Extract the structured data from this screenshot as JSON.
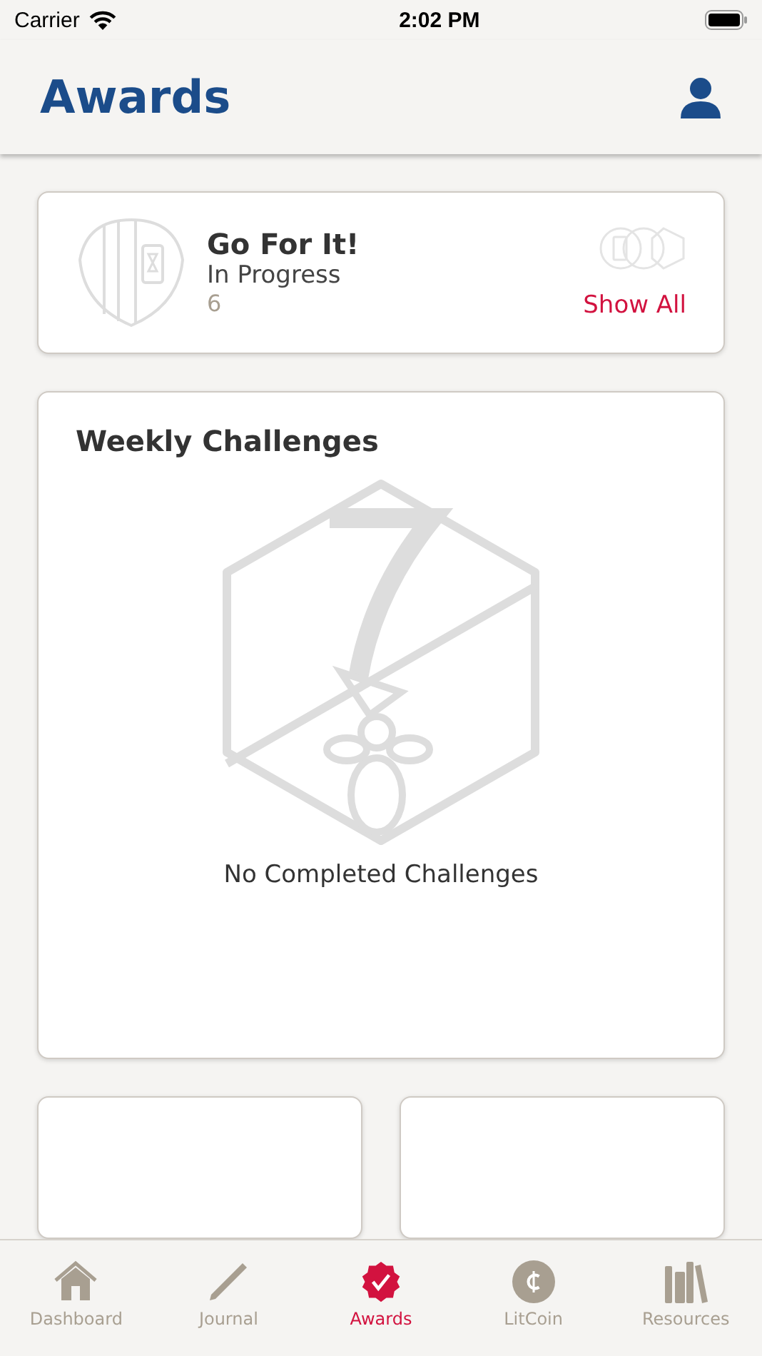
{
  "status_bar": {
    "carrier": "Carrier",
    "time": "2:02 PM"
  },
  "header": {
    "title": "Awards"
  },
  "current_award": {
    "title": "Go For It!",
    "status": "In Progress",
    "count": "6",
    "link": "Show All"
  },
  "weekly": {
    "title": "Weekly Challenges",
    "empty_message": "No Completed Challenges"
  },
  "tabs": [
    {
      "label": "Dashboard",
      "kind": "home",
      "selected": false
    },
    {
      "label": "Journal",
      "kind": "pencil",
      "selected": false
    },
    {
      "label": "Awards",
      "kind": "badge",
      "selected": true
    },
    {
      "label": "LitCoin",
      "kind": "coin",
      "selected": false
    },
    {
      "label": "Resources",
      "kind": "books",
      "selected": false
    }
  ]
}
